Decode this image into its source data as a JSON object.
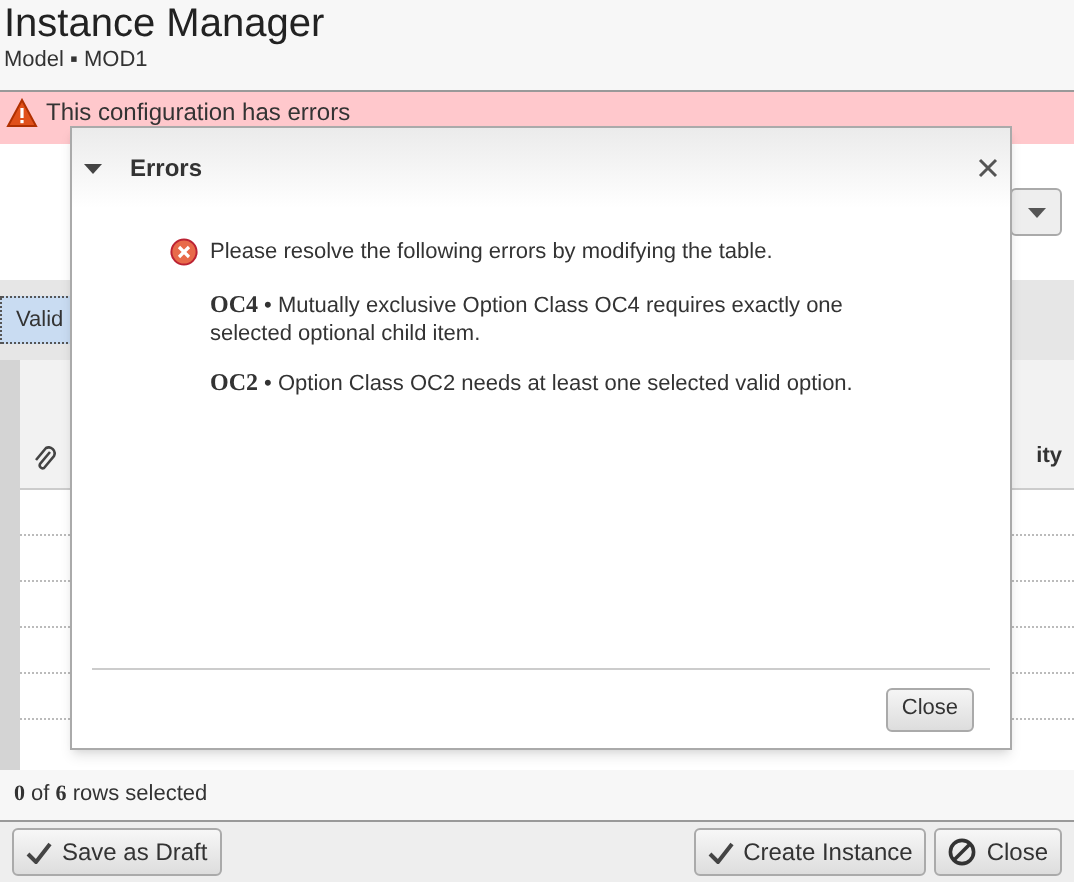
{
  "header": {
    "title": "Instance Manager",
    "subtitle": "Model ▪ MOD1"
  },
  "banner": {
    "message": "This configuration has errors"
  },
  "toolbar": {
    "buttons": [
      "Valid"
    ]
  },
  "table": {
    "columns": [
      {
        "label": "ity"
      }
    ]
  },
  "status": {
    "text": "**0** of **6** rows selected"
  },
  "dialog": {
    "title": "Errors",
    "intro": "Please resolve the following errors by modifying the table.",
    "errors": [
      {
        "text": "**OC4** • Mutually exclusive Option Class OC4 requires exactly one selected optional child item."
      },
      {
        "text": "**OC2** • Option Class OC2 needs at least one selected valid option."
      }
    ],
    "close_button": "Close"
  },
  "footer": {
    "left_buttons": [
      {
        "label": "Save as Draft",
        "kind": "check"
      }
    ],
    "right_buttons": [
      {
        "label": "Create Instance",
        "kind": "check"
      },
      {
        "label": "Close",
        "kind": "cancel"
      }
    ]
  }
}
